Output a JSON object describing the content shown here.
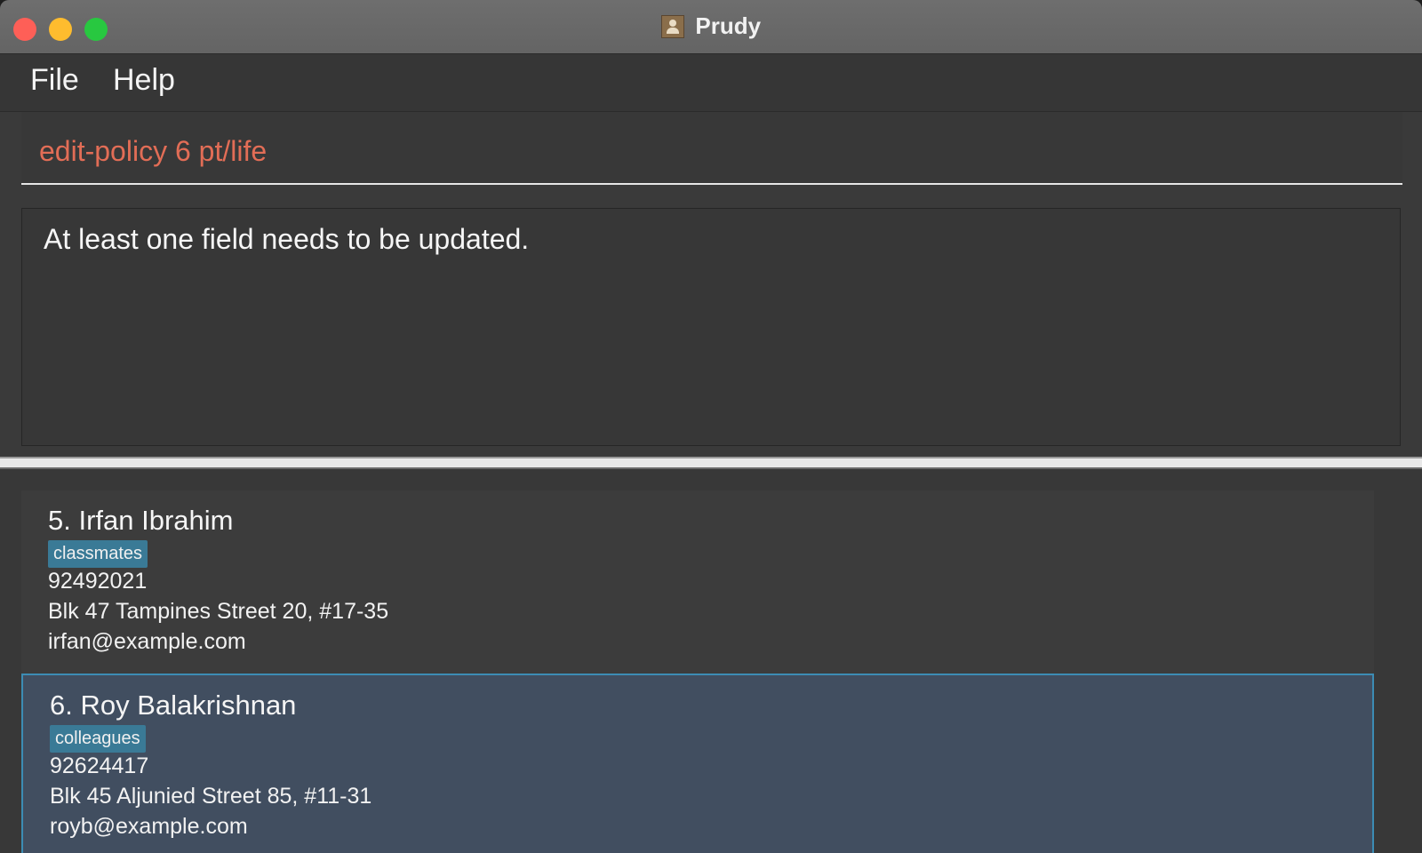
{
  "window": {
    "title": "Prudy"
  },
  "menu": {
    "items": [
      "File",
      "Help"
    ]
  },
  "command_box": {
    "value": "edit-policy 6 pt/life"
  },
  "result_display": {
    "text": "At least one field needs to be updated."
  },
  "persons": [
    {
      "index_name": "5. Irfan Ibrahim",
      "tag": "classmates",
      "phone": "92492021",
      "address": "Blk 47 Tampines Street 20, #17-35",
      "email": "irfan@example.com"
    },
    {
      "index_name": "6. Roy Balakrishnan",
      "tag": "colleagues",
      "phone": "92624417",
      "address": "Blk 45 Aljunied Street 85, #11-31",
      "email": "royb@example.com"
    }
  ],
  "colors": {
    "command_text": "#e26d56",
    "selected_card": "#414e60",
    "tag_bg": "#3a7a96"
  }
}
